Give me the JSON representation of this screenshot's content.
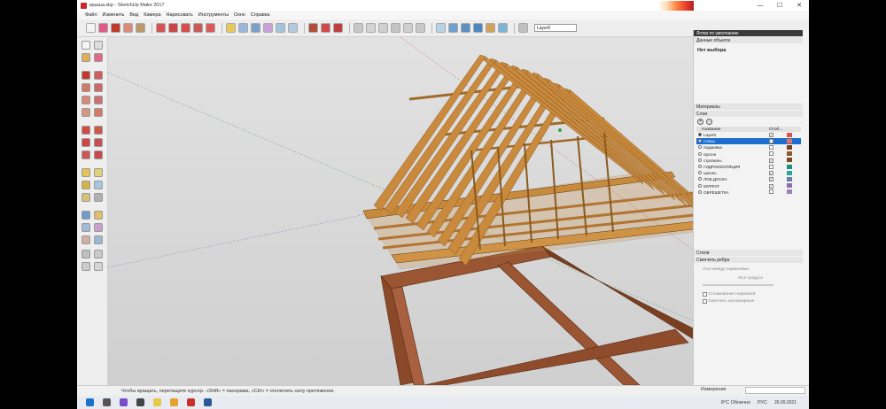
{
  "window": {
    "title": "крыша.skp - SketchUp Make 2017",
    "controls": [
      "—",
      "☐",
      "✕"
    ]
  },
  "menu": [
    "Файл",
    "Изменить",
    "Вид",
    "Камера",
    "Нарисовать",
    "Инструменты",
    "Окно",
    "Справка"
  ],
  "toolbar": {
    "layer_value": "Layer0"
  },
  "tray": {
    "title": "Лотки по умолчанию",
    "entity_info": {
      "header": "Данные объекта",
      "selection": "Нет выбора"
    },
    "materials_header": "Материалы",
    "layers": {
      "header": "Слои",
      "col_name": "Название",
      "col_visible": "Отоб...",
      "rows": [
        {
          "name": "Layer0",
          "visible": true,
          "color": "#d9534f"
        },
        {
          "name": "стены",
          "visible": true,
          "color": "#e9735f",
          "selected": true
        },
        {
          "name": "подшивка",
          "visible": false,
          "color": "#7b3f1d"
        },
        {
          "name": "прогон",
          "visible": false,
          "color": "#8a5a2b"
        },
        {
          "name": "стропилы",
          "visible": true,
          "color": "#7a4a1f"
        },
        {
          "name": "ГИДРОИЗОЛЯЦИЯ",
          "visible": false,
          "color": "#1e8f7a"
        },
        {
          "name": "цоколь",
          "visible": true,
          "color": "#2aa39b"
        },
        {
          "name": "ЛОБ.ДОСКА",
          "visible": true,
          "color": "#6b7fa3"
        },
        {
          "name": "МУРЛАТ",
          "visible": true,
          "color": "#8b6fb0"
        },
        {
          "name": "ОБРЕШЕТКА",
          "visible": false,
          "color": "#9a83b8"
        }
      ]
    },
    "styles_header": "Стили",
    "soften_header": "Смягчить ребра",
    "soften": {
      "angle_label": "Угол между нормалями",
      "angle_value": "20,0 градуса",
      "opt_smooth": "Сглаживание нормалей",
      "opt_coplanar": "Смягчить копланарные"
    }
  },
  "status": {
    "hint": "Чтобы вращать, перетащите курсор. «Shift» = панорама, «Ctrl» = отключить силу притяжения.",
    "measure_label": "Измерения",
    "measure_value": ""
  },
  "taskbar": {
    "weather": "8°C  Облачно",
    "lang": "РУС",
    "date": "26.09.2021"
  },
  "colors": {
    "brick": "#8a4a2a",
    "wood": "#c88a3c",
    "wood_dark": "#8a5a20",
    "select_blue": "#1c6fd1"
  }
}
